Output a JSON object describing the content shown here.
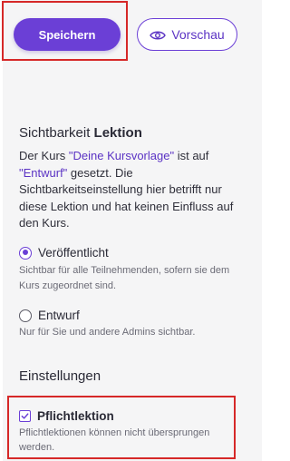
{
  "toolbar": {
    "save_label": "Speichern",
    "preview_label": "Vorschau",
    "accent_color": "#6b3fd6",
    "icons": {
      "preview": "eye-icon"
    }
  },
  "visibility": {
    "title_prefix": "Sichtbarkeit ",
    "title_bold": "Lektion",
    "description": {
      "part1": "Der Kurs ",
      "course_link": "\"Deine Kursvorlage\"",
      "part2": " ist auf ",
      "status_link": "\"Entwurf\"",
      "part3": " gesetzt. Die Sichtbarkeitseinstellung hier betrifft nur diese Lektion und hat keinen Einfluss auf den Kurs."
    },
    "options": [
      {
        "label": "Veröffentlicht",
        "help": "Sichtbar für alle Teilnehmenden, sofern sie dem Kurs zugeordnet sind.",
        "selected": true
      },
      {
        "label": "Entwurf",
        "help": "Nur für Sie und andere Admins sichtbar.",
        "selected": false
      }
    ]
  },
  "settings": {
    "title": "Einstellungen",
    "mandatory": {
      "label": "Pflichtlektion",
      "help": "Pflichtlektionen können nicht übersprungen werden.",
      "checked": true
    }
  }
}
